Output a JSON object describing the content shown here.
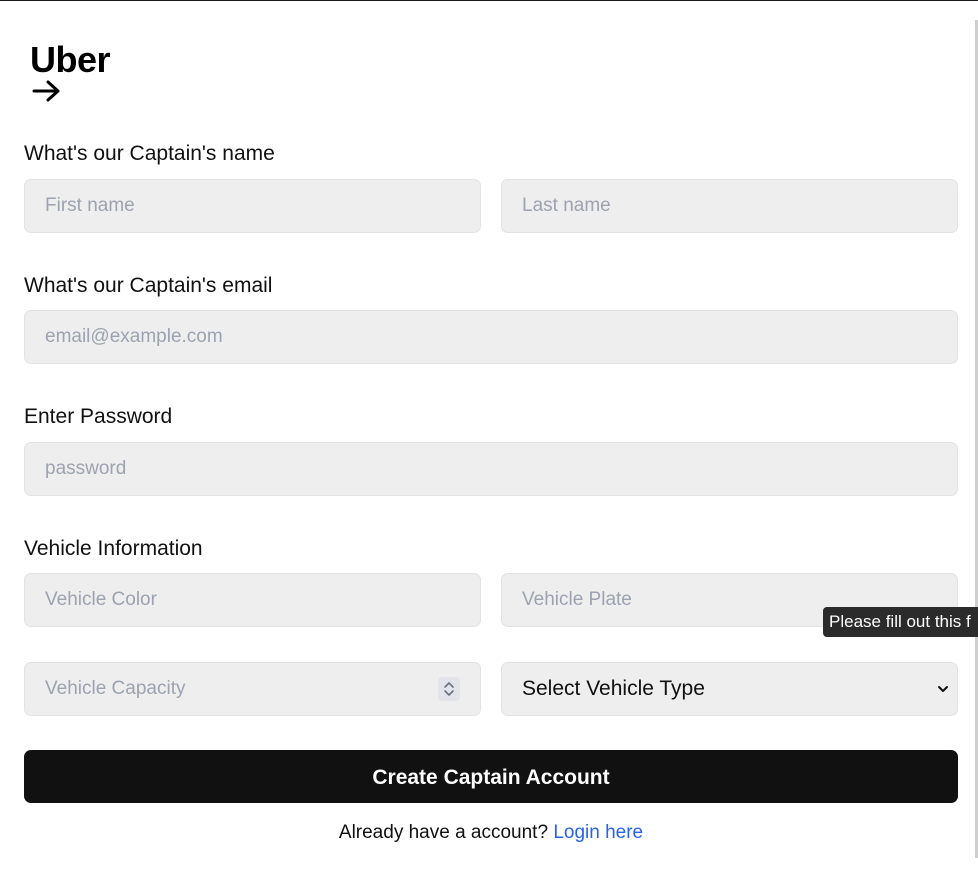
{
  "brand": {
    "logo_text": "Uber"
  },
  "name_section": {
    "label": "What's our Captain's name",
    "first_placeholder": "First name",
    "last_placeholder": "Last name"
  },
  "email_section": {
    "label": "What's our Captain's email",
    "placeholder": "email@example.com"
  },
  "password_section": {
    "label": "Enter Password",
    "placeholder": "password"
  },
  "vehicle_section": {
    "label": "Vehicle Information",
    "color_placeholder": "Vehicle Color",
    "plate_placeholder": "Vehicle Plate",
    "capacity_placeholder": "Vehicle Capacity",
    "type_selected": "Select Vehicle Type"
  },
  "validation_tooltip": "Please fill out this f",
  "submit_label": "Create Captain Account",
  "footer": {
    "prompt": "Already have a account?",
    "link_label": "Login here"
  },
  "icons": {
    "arrow": "arrow-right-icon",
    "spin": "number-spinner-icon",
    "chevron": "chevron-down-icon"
  },
  "colors": {
    "button_bg": "#111111",
    "field_bg": "#eeeeee",
    "link": "#2563eb"
  }
}
